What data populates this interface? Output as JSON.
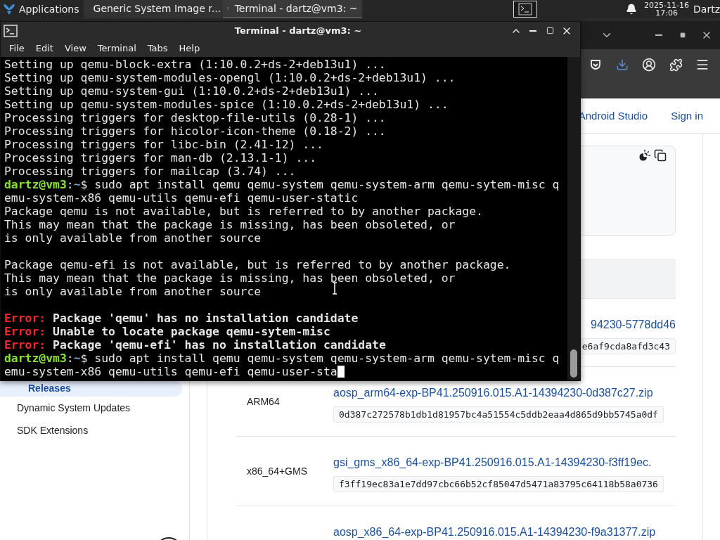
{
  "panel": {
    "apps_label": "Applications",
    "tasks": [
      {
        "label": "Generic System Image r...",
        "kind": "browser",
        "selected": false
      },
      {
        "label": "Terminal - dartz@vm3: ~",
        "kind": "terminal",
        "selected": true
      }
    ],
    "date": "2025-11-16",
    "time": "17:06",
    "user": "Dartz"
  },
  "browser": {
    "header_links": [
      "Android Studio",
      "Sign in"
    ],
    "sidebar": [
      {
        "label": "Releases",
        "selected": true
      },
      {
        "label": "Dynamic System Updates",
        "selected": false
      },
      {
        "label": "SDK Extensions",
        "selected": false
      }
    ],
    "rows": [
      {
        "file": "94230-5778dd46",
        "hash": "e6af9cda8afd3c43",
        "covered": true
      },
      {
        "arch": "ARM64",
        "file": "aosp_arm64-exp-BP41.250916.015.A1-14394230-0d387c27.zip",
        "hash": "0d387c272578b1db1d81957bc4a51554c5ddb2eaa4d865d9bb5745a0df",
        "covered": false
      },
      {
        "arch": "x86_64+GMS",
        "file": "gsi_gms_x86_64-exp-BP41.250916.015.A1-14394230-f3ff19ec.",
        "hash": "f3ff19ec83a1e7dd97cbc66b52cf85047d5471a83795c64118b58a0736",
        "covered": false
      },
      {
        "file": "aosp_x86_64-exp-BP41.250916.015.A1-14394230-f9a31377.zip",
        "covered": false
      }
    ]
  },
  "terminal": {
    "title": "Terminal - dartz@vm3: ~",
    "menu": [
      "File",
      "Edit",
      "View",
      "Terminal",
      "Tabs",
      "Help"
    ],
    "lines": [
      {
        "kind": "output",
        "text": "Setting up qemu-block-extra (1:10.0.2+ds-2+deb13u1) ..."
      },
      {
        "kind": "output",
        "text": "Setting up qemu-system-modules-opengl (1:10.0.2+ds-2+deb13u1) ..."
      },
      {
        "kind": "output",
        "text": "Setting up qemu-system-gui (1:10.0.2+ds-2+deb13u1) ..."
      },
      {
        "kind": "output",
        "text": "Setting up qemu-system-modules-spice (1:10.0.2+ds-2+deb13u1) ..."
      },
      {
        "kind": "output",
        "text": "Processing triggers for desktop-file-utils (0.28-1) ..."
      },
      {
        "kind": "output",
        "text": "Processing triggers for hicolor-icon-theme (0.18-2) ..."
      },
      {
        "kind": "output",
        "text": "Processing triggers for libc-bin (2.41-12) ..."
      },
      {
        "kind": "output",
        "text": "Processing triggers for man-db (2.13.1-1) ..."
      },
      {
        "kind": "output",
        "text": "Processing triggers for mailcap (3.74) ..."
      },
      {
        "kind": "prompt",
        "user": "dartz@vm3",
        "sep": ":",
        "path": "~",
        "text": "$ sudo apt install qemu qemu-system qemu-system-arm qemu-sytem-misc q"
      },
      {
        "kind": "output",
        "text": "emu-system-x86 qemu-utils qemu-efi qemu-user-static"
      },
      {
        "kind": "output",
        "text": "Package qemu is not available, but is referred to by another package."
      },
      {
        "kind": "output",
        "text": "This may mean that the package is missing, has been obsoleted, or"
      },
      {
        "kind": "output",
        "text": "is only available from another source"
      },
      {
        "kind": "blank"
      },
      {
        "kind": "output",
        "text": "Package qemu-efi is not available, but is referred to by another package."
      },
      {
        "kind": "output",
        "text": "This may mean that the package is missing, has been obsoleted, or"
      },
      {
        "kind": "output",
        "text": "is only available from another source"
      },
      {
        "kind": "blank"
      },
      {
        "kind": "error",
        "label": "Error:",
        "text": "Package 'qemu' has no installation candidate"
      },
      {
        "kind": "error",
        "label": "Error:",
        "text": "Unable to locate package qemu-sytem-misc"
      },
      {
        "kind": "error",
        "label": "Error:",
        "text": "Package 'qemu-efi' has no installation candidate"
      },
      {
        "kind": "prompt",
        "user": "dartz@vm3",
        "sep": ":",
        "path": "~",
        "text": "$ sudo apt install qemu qemu-system qemu-system-arm qemu-sytem-misc q"
      },
      {
        "kind": "output",
        "text": "emu-system-x86 qemu-utils qemu-efi qemu-user-sta",
        "cursor": true
      }
    ]
  }
}
